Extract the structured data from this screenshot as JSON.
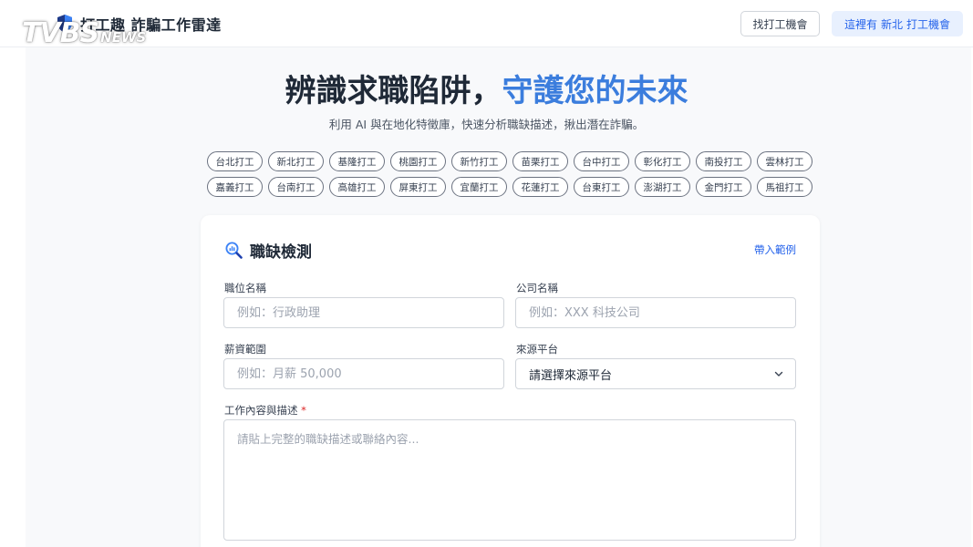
{
  "header": {
    "brand_title": "打工趣 詐騙工作雷達",
    "watermark_main": "TVBS",
    "watermark_sub": "NEWS",
    "find_jobs_button": "找打工機會",
    "local_jobs_prefix": "這裡有",
    "local_jobs_region": "新北",
    "local_jobs_suffix": "打工機會"
  },
  "hero": {
    "title_part1": "辨識求職陷阱，",
    "title_part2": "守護您的未來",
    "subtitle": "利用 AI 與在地化特徵庫，快速分析職缺描述，揪出潛在詐騙。"
  },
  "regions": [
    "台北打工",
    "新北打工",
    "基隆打工",
    "桃園打工",
    "新竹打工",
    "苗栗打工",
    "台中打工",
    "彰化打工",
    "南投打工",
    "雲林打工",
    "嘉義打工",
    "台南打工",
    "高雄打工",
    "屏東打工",
    "宜蘭打工",
    "花蓮打工",
    "台東打工",
    "澎湖打工",
    "金門打工",
    "馬祖打工"
  ],
  "form": {
    "title": "職缺檢測",
    "sample_link": "帶入範例",
    "job_title_label": "職位名稱",
    "job_title_placeholder": "例如：行政助理",
    "job_title_value": "",
    "company_label": "公司名稱",
    "company_placeholder": "例如：XXX 科技公司",
    "company_value": "",
    "salary_label": "薪資範圍",
    "salary_placeholder": "例如：月薪 50,000",
    "salary_value": "",
    "source_label": "來源平台",
    "source_selected": "請選擇來源平台",
    "description_label": "工作內容與描述",
    "required_mark": "*",
    "description_placeholder": "請貼上完整的職缺描述或聯絡內容...",
    "description_value": ""
  },
  "colors": {
    "accent": "#3b7ddd",
    "link": "#2563eb",
    "required": "#dc2626"
  }
}
